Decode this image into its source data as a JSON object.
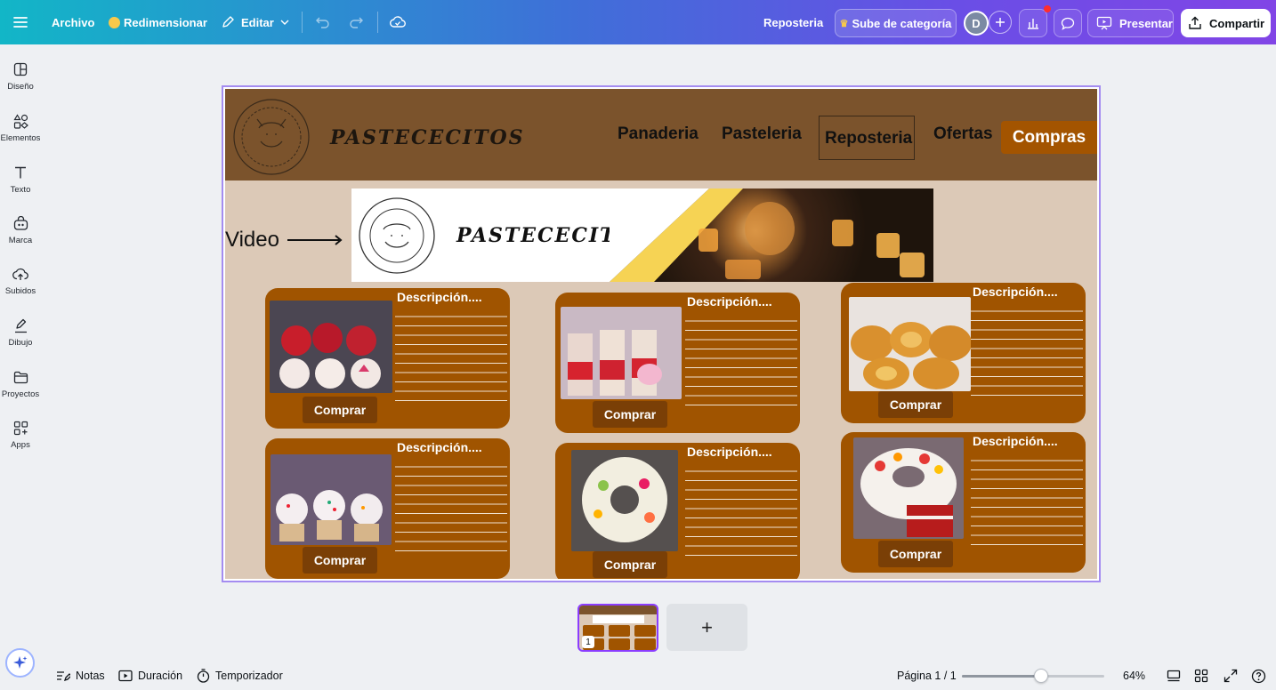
{
  "topbar": {
    "menu_icon": "hamburger-icon",
    "archivo": "Archivo",
    "redimensionar": "Redimensionar",
    "editar": "Editar",
    "project_title": "Reposteria",
    "upgrade": "Sube de categoría",
    "avatar_letter": "D",
    "present": "Presentar",
    "share": "Compartir",
    "colors": {
      "gradient_start": "#12b6c7",
      "gradient_end": "#8145e6"
    }
  },
  "sidebar": {
    "items": [
      {
        "label": "Diseño",
        "icon": "layout-icon"
      },
      {
        "label": "Elementos",
        "icon": "shapes-icon"
      },
      {
        "label": "Texto",
        "icon": "text-icon"
      },
      {
        "label": "Marca",
        "icon": "brand-icon"
      },
      {
        "label": "Subidos",
        "icon": "upload-cloud-icon"
      },
      {
        "label": "Dibujo",
        "icon": "pen-icon"
      },
      {
        "label": "Proyectos",
        "icon": "folder-icon"
      },
      {
        "label": "Apps",
        "icon": "apps-icon"
      }
    ]
  },
  "design": {
    "brand": "PASTECECITOS",
    "nav": [
      "Panaderia",
      "Pasteleria",
      "Reposteria",
      "Ofertas",
      "Compras"
    ],
    "video_label": "Video",
    "banner_title": "PASTECECITOS",
    "description_label": "Descripción....",
    "buy_label": "Comprar",
    "colors": {
      "header": "#7b532c",
      "background": "#dcc9b7",
      "card": "#a05400",
      "button": "#7a3f06"
    }
  },
  "pages": {
    "thumb_number": "1",
    "add_label": "+"
  },
  "bottombar": {
    "notes": "Notas",
    "duration": "Duración",
    "timer": "Temporizador",
    "page_indicator": "Página 1 / 1",
    "zoom": "64%",
    "zoom_fraction": 0.64
  }
}
